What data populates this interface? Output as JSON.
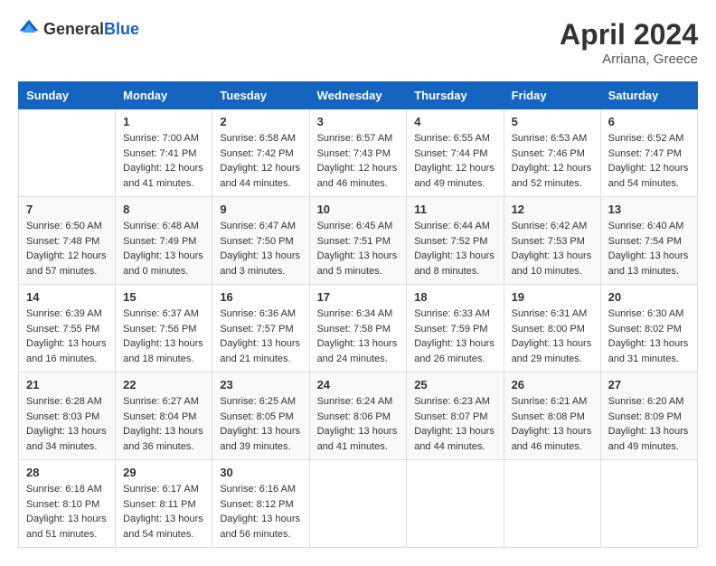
{
  "header": {
    "logo": {
      "general": "General",
      "blue": "Blue"
    },
    "title": "April 2024",
    "location": "Arriana, Greece"
  },
  "weekdays": [
    "Sunday",
    "Monday",
    "Tuesday",
    "Wednesday",
    "Thursday",
    "Friday",
    "Saturday"
  ],
  "weeks": [
    [
      {
        "day": "",
        "sunrise": "",
        "sunset": "",
        "daylight": ""
      },
      {
        "day": "1",
        "sunrise": "Sunrise: 7:00 AM",
        "sunset": "Sunset: 7:41 PM",
        "daylight": "Daylight: 12 hours and 41 minutes."
      },
      {
        "day": "2",
        "sunrise": "Sunrise: 6:58 AM",
        "sunset": "Sunset: 7:42 PM",
        "daylight": "Daylight: 12 hours and 44 minutes."
      },
      {
        "day": "3",
        "sunrise": "Sunrise: 6:57 AM",
        "sunset": "Sunset: 7:43 PM",
        "daylight": "Daylight: 12 hours and 46 minutes."
      },
      {
        "day": "4",
        "sunrise": "Sunrise: 6:55 AM",
        "sunset": "Sunset: 7:44 PM",
        "daylight": "Daylight: 12 hours and 49 minutes."
      },
      {
        "day": "5",
        "sunrise": "Sunrise: 6:53 AM",
        "sunset": "Sunset: 7:46 PM",
        "daylight": "Daylight: 12 hours and 52 minutes."
      },
      {
        "day": "6",
        "sunrise": "Sunrise: 6:52 AM",
        "sunset": "Sunset: 7:47 PM",
        "daylight": "Daylight: 12 hours and 54 minutes."
      }
    ],
    [
      {
        "day": "7",
        "sunrise": "Sunrise: 6:50 AM",
        "sunset": "Sunset: 7:48 PM",
        "daylight": "Daylight: 12 hours and 57 minutes."
      },
      {
        "day": "8",
        "sunrise": "Sunrise: 6:48 AM",
        "sunset": "Sunset: 7:49 PM",
        "daylight": "Daylight: 13 hours and 0 minutes."
      },
      {
        "day": "9",
        "sunrise": "Sunrise: 6:47 AM",
        "sunset": "Sunset: 7:50 PM",
        "daylight": "Daylight: 13 hours and 3 minutes."
      },
      {
        "day": "10",
        "sunrise": "Sunrise: 6:45 AM",
        "sunset": "Sunset: 7:51 PM",
        "daylight": "Daylight: 13 hours and 5 minutes."
      },
      {
        "day": "11",
        "sunrise": "Sunrise: 6:44 AM",
        "sunset": "Sunset: 7:52 PM",
        "daylight": "Daylight: 13 hours and 8 minutes."
      },
      {
        "day": "12",
        "sunrise": "Sunrise: 6:42 AM",
        "sunset": "Sunset: 7:53 PM",
        "daylight": "Daylight: 13 hours and 10 minutes."
      },
      {
        "day": "13",
        "sunrise": "Sunrise: 6:40 AM",
        "sunset": "Sunset: 7:54 PM",
        "daylight": "Daylight: 13 hours and 13 minutes."
      }
    ],
    [
      {
        "day": "14",
        "sunrise": "Sunrise: 6:39 AM",
        "sunset": "Sunset: 7:55 PM",
        "daylight": "Daylight: 13 hours and 16 minutes."
      },
      {
        "day": "15",
        "sunrise": "Sunrise: 6:37 AM",
        "sunset": "Sunset: 7:56 PM",
        "daylight": "Daylight: 13 hours and 18 minutes."
      },
      {
        "day": "16",
        "sunrise": "Sunrise: 6:36 AM",
        "sunset": "Sunset: 7:57 PM",
        "daylight": "Daylight: 13 hours and 21 minutes."
      },
      {
        "day": "17",
        "sunrise": "Sunrise: 6:34 AM",
        "sunset": "Sunset: 7:58 PM",
        "daylight": "Daylight: 13 hours and 24 minutes."
      },
      {
        "day": "18",
        "sunrise": "Sunrise: 6:33 AM",
        "sunset": "Sunset: 7:59 PM",
        "daylight": "Daylight: 13 hours and 26 minutes."
      },
      {
        "day": "19",
        "sunrise": "Sunrise: 6:31 AM",
        "sunset": "Sunset: 8:00 PM",
        "daylight": "Daylight: 13 hours and 29 minutes."
      },
      {
        "day": "20",
        "sunrise": "Sunrise: 6:30 AM",
        "sunset": "Sunset: 8:02 PM",
        "daylight": "Daylight: 13 hours and 31 minutes."
      }
    ],
    [
      {
        "day": "21",
        "sunrise": "Sunrise: 6:28 AM",
        "sunset": "Sunset: 8:03 PM",
        "daylight": "Daylight: 13 hours and 34 minutes."
      },
      {
        "day": "22",
        "sunrise": "Sunrise: 6:27 AM",
        "sunset": "Sunset: 8:04 PM",
        "daylight": "Daylight: 13 hours and 36 minutes."
      },
      {
        "day": "23",
        "sunrise": "Sunrise: 6:25 AM",
        "sunset": "Sunset: 8:05 PM",
        "daylight": "Daylight: 13 hours and 39 minutes."
      },
      {
        "day": "24",
        "sunrise": "Sunrise: 6:24 AM",
        "sunset": "Sunset: 8:06 PM",
        "daylight": "Daylight: 13 hours and 41 minutes."
      },
      {
        "day": "25",
        "sunrise": "Sunrise: 6:23 AM",
        "sunset": "Sunset: 8:07 PM",
        "daylight": "Daylight: 13 hours and 44 minutes."
      },
      {
        "day": "26",
        "sunrise": "Sunrise: 6:21 AM",
        "sunset": "Sunset: 8:08 PM",
        "daylight": "Daylight: 13 hours and 46 minutes."
      },
      {
        "day": "27",
        "sunrise": "Sunrise: 6:20 AM",
        "sunset": "Sunset: 8:09 PM",
        "daylight": "Daylight: 13 hours and 49 minutes."
      }
    ],
    [
      {
        "day": "28",
        "sunrise": "Sunrise: 6:18 AM",
        "sunset": "Sunset: 8:10 PM",
        "daylight": "Daylight: 13 hours and 51 minutes."
      },
      {
        "day": "29",
        "sunrise": "Sunrise: 6:17 AM",
        "sunset": "Sunset: 8:11 PM",
        "daylight": "Daylight: 13 hours and 54 minutes."
      },
      {
        "day": "30",
        "sunrise": "Sunrise: 6:16 AM",
        "sunset": "Sunset: 8:12 PM",
        "daylight": "Daylight: 13 hours and 56 minutes."
      },
      {
        "day": "",
        "sunrise": "",
        "sunset": "",
        "daylight": ""
      },
      {
        "day": "",
        "sunrise": "",
        "sunset": "",
        "daylight": ""
      },
      {
        "day": "",
        "sunrise": "",
        "sunset": "",
        "daylight": ""
      },
      {
        "day": "",
        "sunrise": "",
        "sunset": "",
        "daylight": ""
      }
    ]
  ]
}
